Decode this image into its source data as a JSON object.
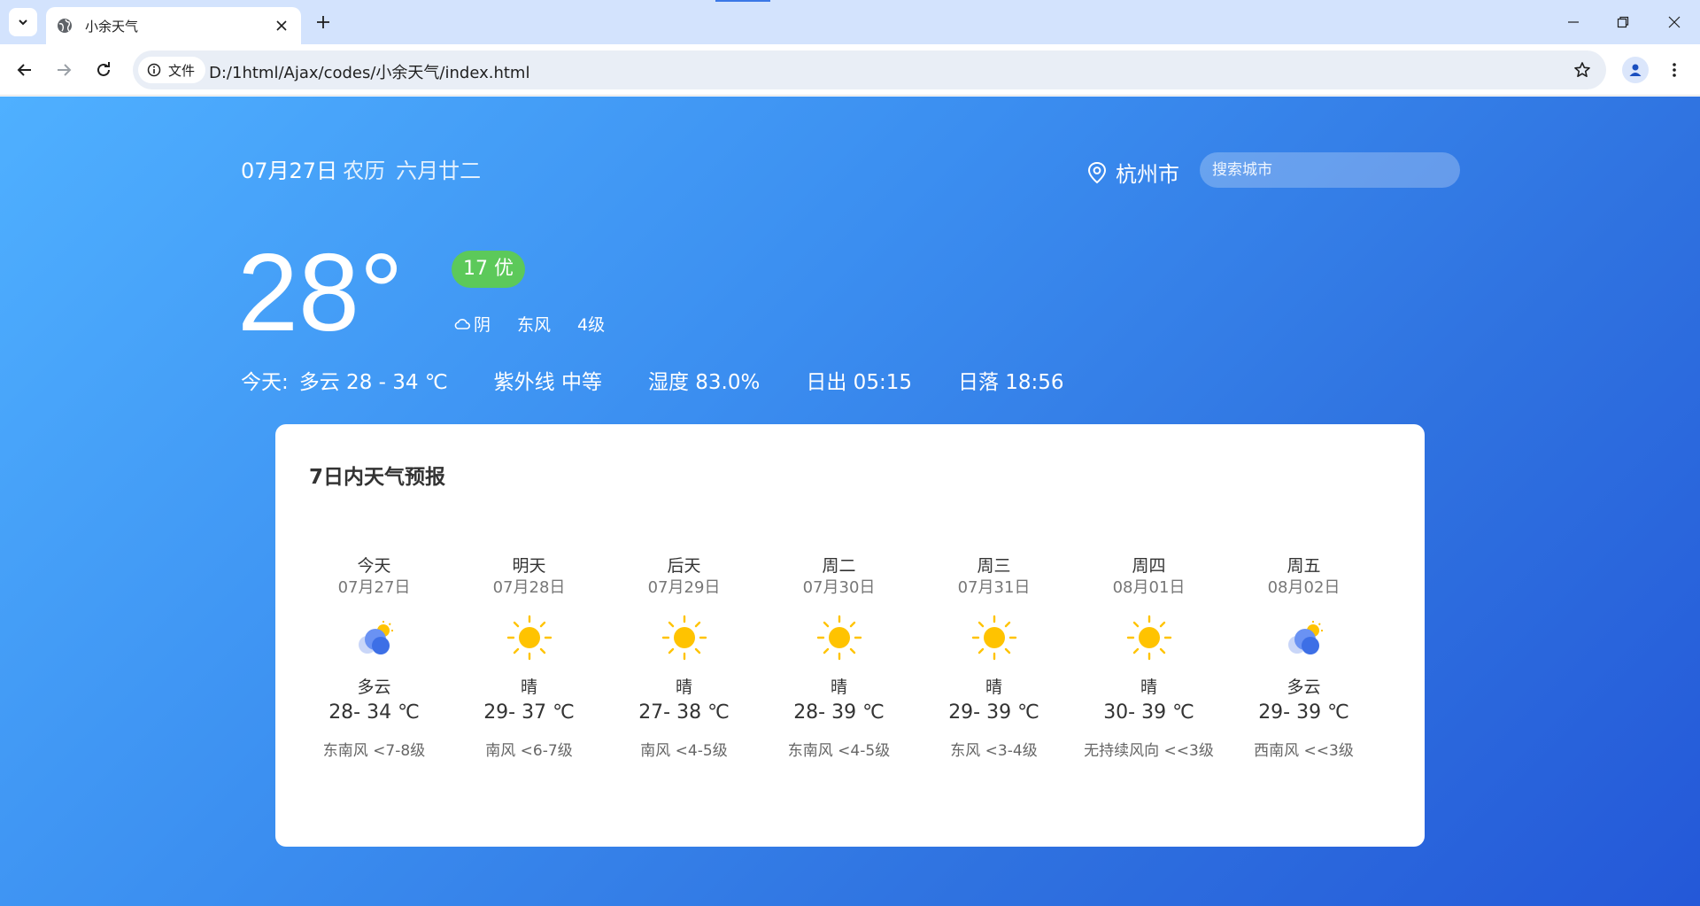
{
  "browser": {
    "tab_title": "小余天气",
    "site_info_label": "文件",
    "url": "D:/1html/Ajax/codes/小余天气/index.html"
  },
  "header": {
    "date": "07月27日",
    "lunar_label": "农历",
    "lunar_date": "六月廿二",
    "city": "杭州市",
    "search_placeholder": "搜索城市"
  },
  "current": {
    "temperature": "28°",
    "aqi": "17 优",
    "weather": "阴",
    "wind_direction": "东风",
    "wind_level": "4级"
  },
  "today": {
    "label": "今天:",
    "summary": "多云 28 - 34 ℃",
    "uv": "紫外线 中等",
    "humidity": "湿度 83.0%",
    "sunrise": "日出 05:15",
    "sunset": "日落 18:56"
  },
  "forecast": {
    "title": "7日内天气预报",
    "days": [
      {
        "name": "今天",
        "date": "07月27日",
        "icon": "partly-cloudy-icon",
        "desc": "多云",
        "range": "28- 34 ℃",
        "wind": "东南风 <7-8级"
      },
      {
        "name": "明天",
        "date": "07月28日",
        "icon": "sun-icon",
        "desc": "晴",
        "range": "29- 37 ℃",
        "wind": "南风 <6-7级"
      },
      {
        "name": "后天",
        "date": "07月29日",
        "icon": "sun-icon",
        "desc": "晴",
        "range": "27- 38 ℃",
        "wind": "南风 <4-5级"
      },
      {
        "name": "周二",
        "date": "07月30日",
        "icon": "sun-icon",
        "desc": "晴",
        "range": "28- 39 ℃",
        "wind": "东南风 <4-5级"
      },
      {
        "name": "周三",
        "date": "07月31日",
        "icon": "sun-icon",
        "desc": "晴",
        "range": "29- 39 ℃",
        "wind": "东风 <3-4级"
      },
      {
        "name": "周四",
        "date": "08月01日",
        "icon": "sun-icon",
        "desc": "晴",
        "range": "30- 39 ℃",
        "wind": "无持续风向 <<3级"
      },
      {
        "name": "周五",
        "date": "08月02日",
        "icon": "partly-cloudy-icon",
        "desc": "多云",
        "range": "29- 39 ℃",
        "wind": "西南风 <<3级"
      }
    ]
  },
  "colors": {
    "aqi_good": "#5cc95a",
    "sun": "#ffc300",
    "cloud": "#4a7cf0",
    "background_start": "#4fb0ff",
    "background_end": "#2458d8"
  }
}
